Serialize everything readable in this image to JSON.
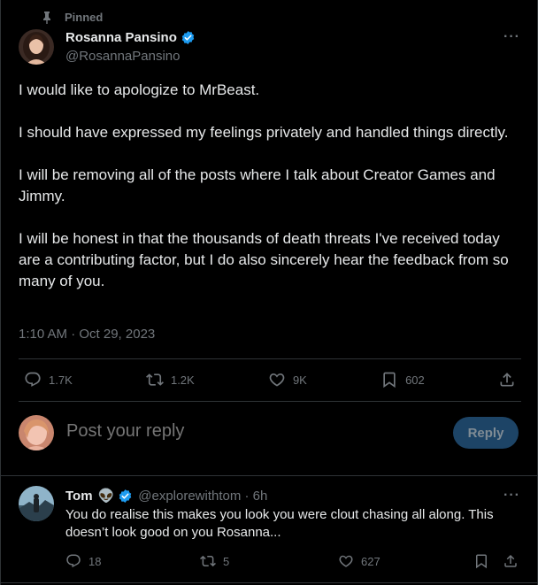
{
  "pinned_label": "Pinned",
  "tweet": {
    "author_name": "Rosanna Pansino",
    "author_handle": "@RosannaPansino",
    "more_label": "···",
    "paragraphs": [
      "I would like to apologize to MrBeast.",
      "I should have expressed my feelings privately and handled things directly.",
      "I will be removing all of the posts where I talk about Creator Games and Jimmy.",
      "I will be honest in that the thousands of death threats I've received today are a contributing factor, but I do also sincerely hear the feedback from so many of you."
    ],
    "timestamp": "1:10 AM · Oct 29, 2023",
    "stats": {
      "replies": "1.7K",
      "reposts": "1.2K",
      "likes": "9K",
      "bookmarks": "602"
    }
  },
  "reply_box": {
    "placeholder": "Post your reply",
    "button_label": "Reply"
  },
  "comment": {
    "author_name": "Tom",
    "emoji": "👽",
    "handle_time": "@explorewithtom · 6h",
    "more_label": "···",
    "text": "You do realise this makes you look you were clout chasing all along. This doesn’t look good on you Rosanna...",
    "stats": {
      "replies": "18",
      "reposts": "5",
      "likes": "627"
    }
  },
  "colors": {
    "background": "#000000",
    "text": "#e7e9ea",
    "muted": "#71767b",
    "verified": "#1d9bf0",
    "reply_button_bg": "#1d4466",
    "divider": "#2f3336"
  }
}
